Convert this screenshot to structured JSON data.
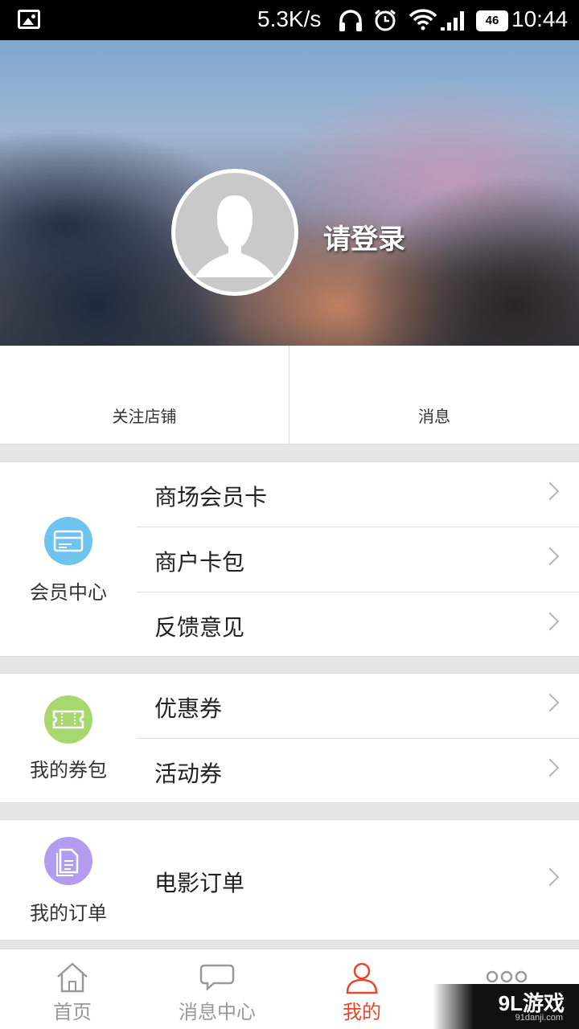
{
  "status_bar": {
    "speed": "5.3K/s",
    "battery": "46",
    "time": "10:44"
  },
  "header": {
    "login_text": "请登录"
  },
  "stats": {
    "follow_label": "关注店铺",
    "message_label": "消息"
  },
  "sections": {
    "member": {
      "title": "会员中心",
      "icon": "card-icon",
      "icon_color": "#6ec3ef",
      "rows": [
        {
          "label": "商场会员卡"
        },
        {
          "label": "商户卡包"
        },
        {
          "label": "反馈意见"
        }
      ]
    },
    "coupons": {
      "title": "我的券包",
      "icon": "ticket-icon",
      "icon_color": "#a6d86f",
      "rows": [
        {
          "label": "优惠券"
        },
        {
          "label": "活动券"
        }
      ]
    },
    "orders": {
      "title": "我的订单",
      "icon": "document-icon",
      "icon_color": "#b39cf0",
      "rows": [
        {
          "label": "电影订单"
        }
      ]
    }
  },
  "bottom_nav": {
    "items": [
      {
        "label": "首页",
        "icon": "home-icon",
        "active": false
      },
      {
        "label": "消息中心",
        "icon": "chat-icon",
        "active": false
      },
      {
        "label": "我的",
        "icon": "user-icon",
        "active": true
      },
      {
        "label": "",
        "icon": "more-icon",
        "active": false
      }
    ],
    "active_color": "#e8452c",
    "inactive_color": "#999999"
  },
  "watermark": {
    "main": "9L游戏",
    "sub": "91danji.com"
  }
}
